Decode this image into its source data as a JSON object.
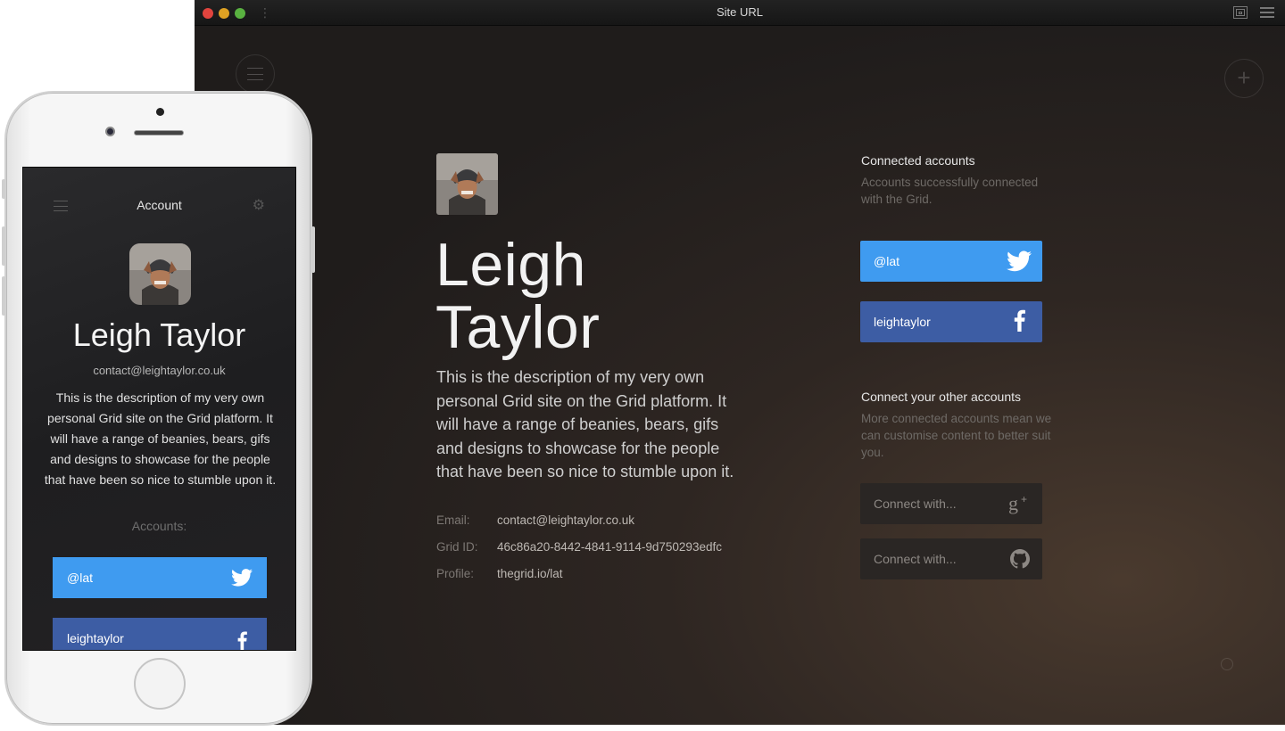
{
  "window": {
    "title": "Site URL"
  },
  "profile": {
    "name_line1": "Leigh",
    "name_line2": "Taylor",
    "description": "This is the description of my very own personal Grid site on the Grid platform. It will have a range of beanies, bears, gifs and designs to showcase for the people that have been so nice to stumble upon it.",
    "info": [
      {
        "label": "Email:",
        "value": "contact@leightaylor.co.uk"
      },
      {
        "label": "Grid ID:",
        "value": "46c86a20-8442-4841-9114-9d750293edfc"
      },
      {
        "label": "Profile:",
        "value": "thegrid.io/lat"
      }
    ]
  },
  "connected": {
    "title": "Connected accounts",
    "subtitle": "Accounts successfully connected with the Grid.",
    "accounts": [
      {
        "label": "@lat",
        "icon": "twitter-icon",
        "color": "#3f9bf0"
      },
      {
        "label": "leightaylor",
        "icon": "facebook-icon",
        "color": "#3d5da4"
      }
    ]
  },
  "other": {
    "title": "Connect your other accounts",
    "subtitle": "More connected accounts mean we can customise content to better suit you.",
    "buttons": [
      {
        "label": "Connect with...",
        "icon": "google-plus-icon"
      },
      {
        "label": "Connect with...",
        "icon": "github-icon"
      }
    ]
  },
  "mobile": {
    "header_title": "Account",
    "name": "Leigh Taylor",
    "email": "contact@leightaylor.co.uk",
    "description": "This is the description of my very own personal Grid site on the Grid platform. It will have a range of beanies, bears, gifs and designs to showcase for the people that have been so nice to stumble upon it.",
    "accounts_label": "Accounts:",
    "accounts": [
      {
        "label": "@lat",
        "icon": "twitter-icon"
      },
      {
        "label": "leightaylor",
        "icon": "facebook-icon"
      }
    ]
  }
}
